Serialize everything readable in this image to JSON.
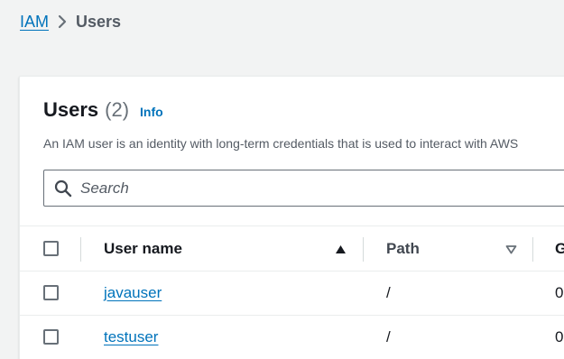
{
  "breadcrumb": {
    "root_label": "IAM",
    "current_label": "Users"
  },
  "panel": {
    "title": "Users",
    "count": "(2)",
    "info_label": "Info",
    "description": "An IAM user is an identity with long-term credentials that is used to interact with AWS"
  },
  "search": {
    "placeholder": "Search",
    "value": ""
  },
  "table": {
    "columns": [
      {
        "label": "User name",
        "sort": "ascending"
      },
      {
        "label": "Path",
        "sort": "unsorted"
      },
      {
        "label": "G",
        "sort": "none"
      }
    ],
    "rows": [
      {
        "user_name": "javauser",
        "path": "/",
        "third": "0"
      },
      {
        "user_name": "testuser",
        "path": "/",
        "third": "0"
      }
    ]
  },
  "icons": {
    "breadcrumb_separator": "chevron-right-icon",
    "search": "search-icon",
    "sort_ascending": "caret-up-filled-icon",
    "sort_unsorted": "caret-down-outline-icon"
  },
  "colors": {
    "link": "#0073bb",
    "text": "#16191f",
    "muted": "#545b64",
    "background": "#f2f3f3",
    "border": "#eaeded"
  }
}
